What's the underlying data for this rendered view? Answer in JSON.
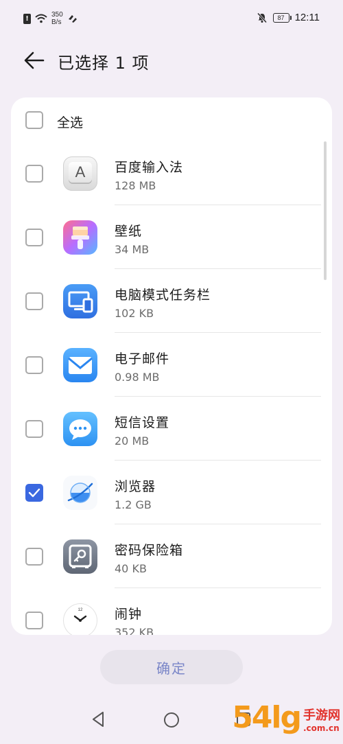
{
  "status_bar": {
    "alert_glyph": "!",
    "net_speed_value": "350",
    "net_speed_unit": "B/s",
    "battery": "87",
    "time": "12:11"
  },
  "header": {
    "title": "已选择 1 项"
  },
  "select_all": {
    "label": "全选",
    "checked": false
  },
  "apps": [
    {
      "name": "百度输入法",
      "size": "128 MB",
      "checked": false,
      "icon": "keyboard-app-icon"
    },
    {
      "name": "壁纸",
      "size": "34 MB",
      "checked": false,
      "icon": "wallpaper-app-icon"
    },
    {
      "name": "电脑模式任务栏",
      "size": "102 KB",
      "checked": false,
      "icon": "desktop-mode-app-icon"
    },
    {
      "name": "电子邮件",
      "size": "0.98 MB",
      "checked": false,
      "icon": "email-app-icon"
    },
    {
      "name": "短信设置",
      "size": "20 MB",
      "checked": false,
      "icon": "messaging-app-icon"
    },
    {
      "name": "浏览器",
      "size": "1.2 GB",
      "checked": true,
      "icon": "browser-app-icon"
    },
    {
      "name": "密码保险箱",
      "size": "40 KB",
      "checked": false,
      "icon": "password-vault-app-icon"
    },
    {
      "name": "闹钟",
      "size": "352 KB",
      "checked": false,
      "icon": "clock-app-icon"
    }
  ],
  "confirm_button": {
    "label": "确定"
  },
  "icons": {
    "keyboard_letter": "A",
    "clock_number": "12"
  },
  "watermark": {
    "logo": "54lg",
    "name": "手游网",
    "domain": ".com.cn"
  },
  "colors": {
    "accent": "#3a68e0",
    "background": "#f3eef6",
    "card": "#ffffff",
    "confirm_text": "#7a86c8"
  }
}
